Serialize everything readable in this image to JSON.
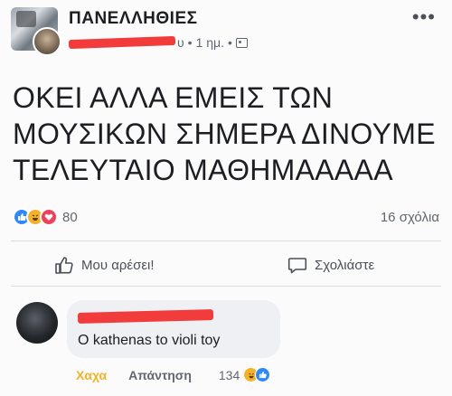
{
  "post": {
    "group_name": "ΠΑΝΕΛΛΗΘΙΕΣ",
    "author_tail": "υ",
    "time": "1 ημ.",
    "separator": "•",
    "more": "•••",
    "text_lines": [
      "ΟΚΕΙ ΑΛΛΑ ΕΜΕΙΣ ΤΩΝ",
      "ΜΟΥΣΙΚΩΝ ΣΗΜΕΡΑ ΔΙΝΟΥΜΕ",
      "ΤΕΛΕΥΤΑΙΟ ΜΑΘΗΜΑΑΑΑΑ"
    ],
    "reaction_count": "80",
    "comments_count": "16 σχόλια",
    "like_label": "Μου αρέσει!",
    "comment_label": "Σχολιάστε"
  },
  "comment": {
    "text": "O kathenas to violi toy",
    "react_label": "Χαχα",
    "reply_label": "Απάντηση",
    "reaction_count": "134"
  },
  "colors": {
    "like_blue": "#2d88ff",
    "haha_yellow": "#f7b125",
    "love_red": "#f33e58",
    "redaction": "#f23c3c"
  },
  "icons": [
    "more-icon",
    "group-privacy-icon",
    "like-reaction-icon",
    "haha-reaction-icon",
    "love-reaction-icon",
    "thumbs-up-icon",
    "comment-bubble-icon"
  ]
}
